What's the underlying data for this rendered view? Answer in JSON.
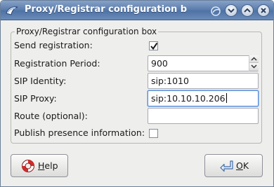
{
  "window": {
    "title": "Proxy/Registrar configuration b"
  },
  "group": {
    "title": "Proxy/Registrar configuration box"
  },
  "fields": {
    "send_registration": {
      "label": "Send registration:",
      "checked": true
    },
    "registration_period": {
      "label": "Registration Period:",
      "value": "900"
    },
    "sip_identity": {
      "label": "SIP Identity:",
      "value": "sip:1010"
    },
    "sip_proxy": {
      "label": "SIP Proxy:",
      "value": "sip:10.10.10.206"
    },
    "route": {
      "label": "Route (optional):",
      "value": ""
    },
    "publish_presence": {
      "label": "Publish presence information:",
      "checked": false
    }
  },
  "buttons": {
    "help": {
      "mnemonic": "H",
      "rest": "elp",
      "icon": "lifebuoy-icon"
    },
    "ok": {
      "mnemonic": "O",
      "rest": "K",
      "icon": "enter-arrow-icon"
    }
  },
  "colors": {
    "titlebar": "#5d7fae",
    "focus_ring": "#5a8ed6",
    "window_bg": "#eeeeec"
  }
}
